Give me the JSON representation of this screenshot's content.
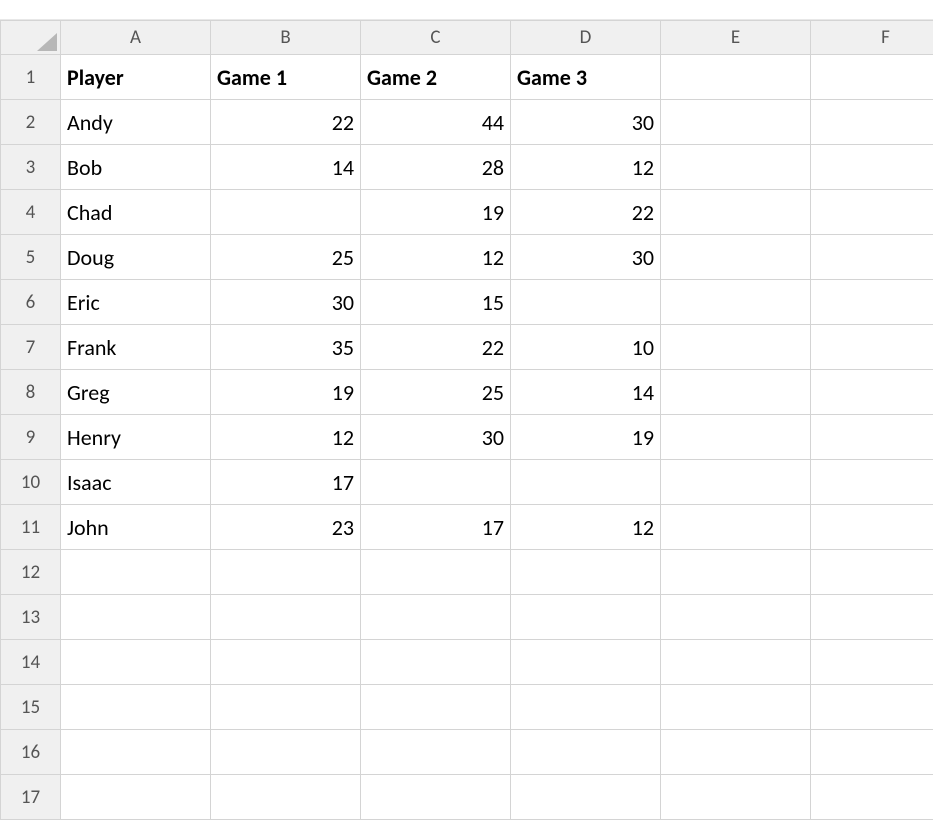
{
  "columns": [
    "A",
    "B",
    "C",
    "D",
    "E",
    "F"
  ],
  "row_count": 17,
  "headers": {
    "A": "Player",
    "B": "Game 1",
    "C": "Game 2",
    "D": "Game 3"
  },
  "rows": [
    {
      "player": "Andy",
      "g1": 22,
      "g2": 44,
      "g3": 30
    },
    {
      "player": "Bob",
      "g1": 14,
      "g2": 28,
      "g3": 12
    },
    {
      "player": "Chad",
      "g1": "",
      "g2": 19,
      "g3": 22
    },
    {
      "player": "Doug",
      "g1": 25,
      "g2": 12,
      "g3": 30
    },
    {
      "player": "Eric",
      "g1": 30,
      "g2": 15,
      "g3": ""
    },
    {
      "player": "Frank",
      "g1": 35,
      "g2": 22,
      "g3": 10
    },
    {
      "player": "Greg",
      "g1": 19,
      "g2": 25,
      "g3": 14
    },
    {
      "player": "Henry",
      "g1": 12,
      "g2": 30,
      "g3": 19
    },
    {
      "player": "Isaac",
      "g1": 17,
      "g2": "",
      "g3": ""
    },
    {
      "player": "John",
      "g1": 23,
      "g2": 17,
      "g3": 12
    }
  ]
}
